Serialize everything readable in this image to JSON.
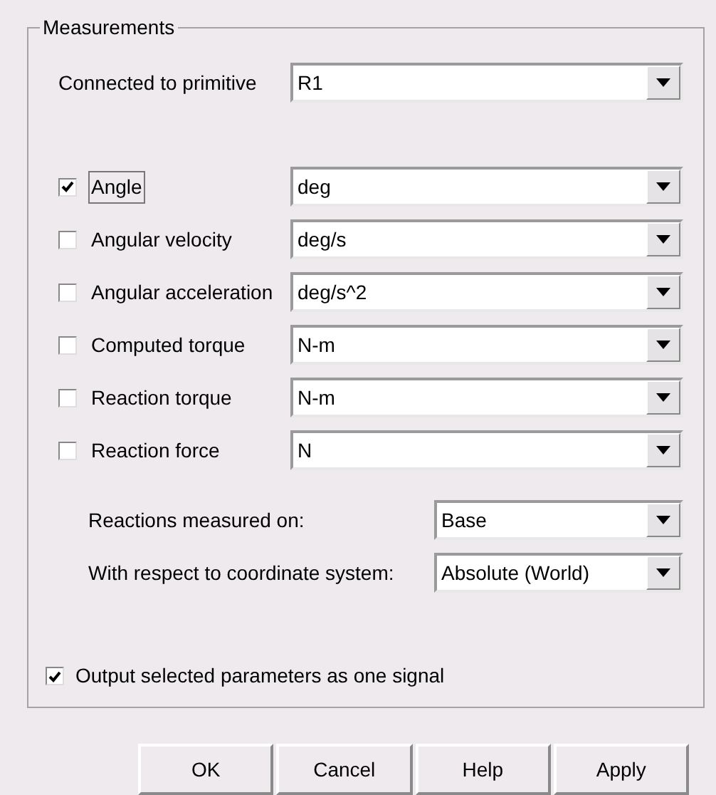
{
  "group": {
    "title": "Measurements"
  },
  "primitive": {
    "label": "Connected to primitive",
    "value": "R1"
  },
  "measurements": [
    {
      "label": "Angle",
      "checked": true,
      "focused": true,
      "unit": "deg"
    },
    {
      "label": "Angular velocity",
      "checked": false,
      "focused": false,
      "unit": "deg/s"
    },
    {
      "label": "Angular acceleration",
      "checked": false,
      "focused": false,
      "unit": "deg/s^2"
    },
    {
      "label": "Computed torque",
      "checked": false,
      "focused": false,
      "unit": "N-m"
    },
    {
      "label": "Reaction torque",
      "checked": false,
      "focused": false,
      "unit": "N-m"
    },
    {
      "label": "Reaction force",
      "checked": false,
      "focused": false,
      "unit": "N"
    }
  ],
  "reactions": [
    {
      "label": "Reactions measured on:",
      "value": "Base"
    },
    {
      "label": "With respect to coordinate system:",
      "value": "Absolute (World)"
    }
  ],
  "output_option": {
    "label": "Output selected parameters as one signal",
    "checked": true
  },
  "buttons": [
    "OK",
    "Cancel",
    "Help",
    "Apply"
  ]
}
